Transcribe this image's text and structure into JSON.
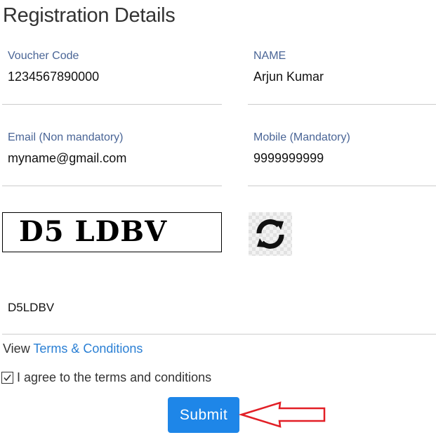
{
  "page": {
    "title": "Registration Details"
  },
  "fields": {
    "voucher": {
      "label": "Voucher Code",
      "value": "1234567890000"
    },
    "name": {
      "label": "NAME",
      "value": "Arjun Kumar"
    },
    "email": {
      "label": "Email (Non mandatory)",
      "value": "myname@gmail.com"
    },
    "mobile": {
      "label": "Mobile (Mandatory)",
      "value": "9999999999"
    }
  },
  "captcha": {
    "image_text": "D5 LDBV",
    "input_value": "D5LDBV",
    "refresh_icon": "refresh-icon"
  },
  "terms": {
    "prefix": "View ",
    "link_text": "Terms & Conditions",
    "agree_label": "I agree to the terms and conditions",
    "agree_checked": true
  },
  "actions": {
    "submit_label": "Submit"
  },
  "annotation": {
    "arrow_color": "#e21f26",
    "arrow_target": "submit-button"
  },
  "colors": {
    "label": "#4a6596",
    "link": "#2a7fd4",
    "submit_bg": "#1e86e8"
  }
}
